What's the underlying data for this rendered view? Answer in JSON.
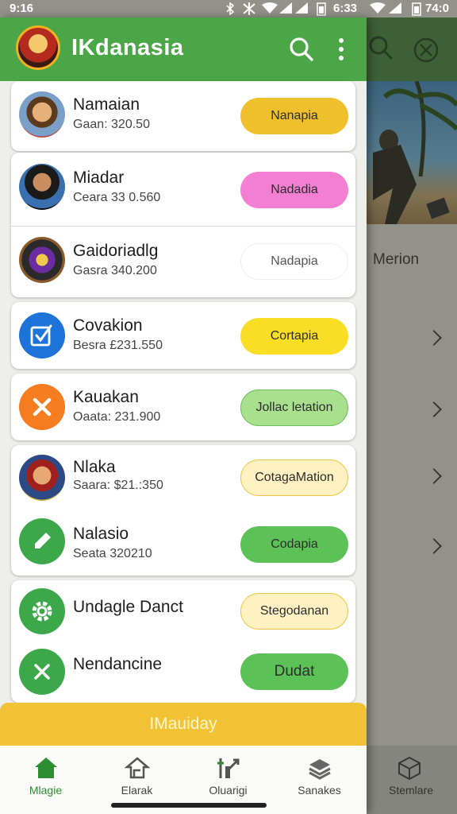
{
  "status": {
    "time_left": "9:16",
    "time_mid": "6:33",
    "time_right": "74:0"
  },
  "app": {
    "title": "IKdanasia",
    "search_icon": "search-icon",
    "menu_icon": "more-vert-icon",
    "accent": "#4aa646"
  },
  "items": [
    {
      "name": "Namaian",
      "sub": "Gaan: 320.50",
      "button": "Nanapia",
      "button_color": "#f0bf2c"
    },
    {
      "name": "Miadar",
      "sub": "Ceara  33 0.560",
      "button": "Nadadia",
      "button_color": "#f27fd2"
    },
    {
      "name": "Gaidoriadlg",
      "sub": "Gasra  340.200",
      "button": "Nadapia",
      "button_color": "#ffffff"
    },
    {
      "name": "Covakion",
      "sub": "Besra  £231.550",
      "button": "Cortapia",
      "button_color": "#f9de25"
    },
    {
      "name": "Kauakan",
      "sub": "Oaata: 231.900",
      "button": "Jollac letation",
      "button_color": "#a8e08e"
    },
    {
      "name": "Nlaka",
      "sub": "Saara: $21.:350",
      "button": "CotagaMation",
      "button_color": "#fff1c2"
    },
    {
      "name": "Nalasio",
      "sub": "Seata  320210",
      "button": "Codapia",
      "button_color": "#5cc258"
    },
    {
      "name": "Undagle Danct",
      "sub": "",
      "button": "Stegodanan",
      "button_color": "#fff1c2"
    },
    {
      "name": "Nendancine",
      "sub": "",
      "button": "Dudat",
      "button_color": "#5cc258"
    }
  ],
  "cta": {
    "label": "IMauiday"
  },
  "nav": [
    {
      "label": "Mlagie",
      "icon": "home-icon"
    },
    {
      "label": "Elarak",
      "icon": "house-outline-icon"
    },
    {
      "label": "Oluarigi",
      "icon": "chart-up-icon"
    },
    {
      "label": "Sanakes",
      "icon": "layers-icon"
    }
  ],
  "background": {
    "list_title": "Merion",
    "nav_label": "Stemlare"
  }
}
